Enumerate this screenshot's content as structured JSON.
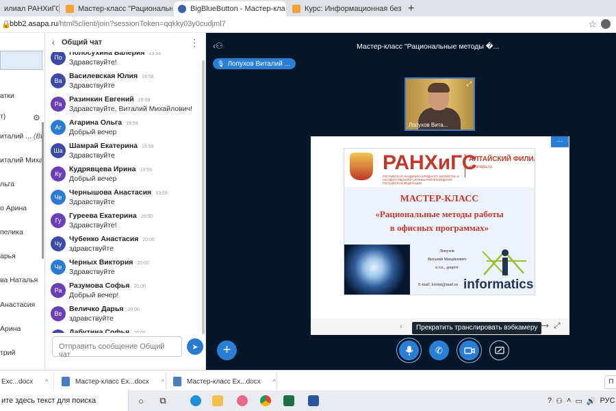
{
  "tabs": [
    {
      "label": "илиал РАНХиГС",
      "active": false
    },
    {
      "label": "Мастер-класс \"Рациональные м",
      "active": false
    },
    {
      "label": "BigBlueButton - Мастер-кла",
      "active": true
    },
    {
      "label": "Курс: Информационная безопа",
      "active": false
    }
  ],
  "new_tab": "+",
  "address": {
    "host": "bbb2.asapa.ru",
    "path": "/html5client/join?sessionToken=qqkky03y0cudjml7"
  },
  "users": [
    "",
    "атки",
    "т)",
    "италий ...",
    "италий Миха...",
    "льга",
    "о Арина",
    "пелика",
    "арья",
    "ва Наталья",
    "Анастасия",
    "Арина",
    "трий"
  ],
  "user_you_tag": "(Вы)",
  "chat": {
    "title": "Общий чат",
    "messages": [
      {
        "initials": "По",
        "color": "#3b4aa6",
        "name": "Полосухина Валерия",
        "time": "19:58",
        "text": "Здравствуйте!"
      },
      {
        "initials": "Ва",
        "color": "#3b4aa6",
        "name": "Василевская Юлия",
        "time": "19:58",
        "text": "Здравствуйте"
      },
      {
        "initials": "Ра",
        "color": "#6a3fb3",
        "name": "Разинкин Евгений",
        "time": "19:58",
        "text": "Здравствуйте, Виталий Михайлович!"
      },
      {
        "initials": "Аг",
        "color": "#2b7bd3",
        "name": "Агарина Ольга",
        "time": "19:59",
        "text": "Добрый вечер"
      },
      {
        "initials": "Ша",
        "color": "#3b4aa6",
        "name": "Шамрай Екатерина",
        "time": "19:59",
        "text": "Здравствуйте"
      },
      {
        "initials": "Ку",
        "color": "#6a3fb3",
        "name": "Кудрявцева Ирина",
        "time": "19:59",
        "text": "Добрый вечер"
      },
      {
        "initials": "Че",
        "color": "#2b7bd3",
        "name": "Чернышова Анастасия",
        "time": "19:59",
        "text": "Здравствуйте"
      },
      {
        "initials": "Гу",
        "color": "#6a3fb3",
        "name": "Гуреева Екатерина",
        "time": "20:00",
        "text": "Здравствуйте!"
      },
      {
        "initials": "Чу",
        "color": "#3b4aa6",
        "name": "Чубенко Анастасия",
        "time": "20:00",
        "text": "здравствуйте"
      },
      {
        "initials": "Че",
        "color": "#2b7bd3",
        "name": "Черных Виктория",
        "time": "20:00",
        "text": "Здравствуйте"
      },
      {
        "initials": "Ра",
        "color": "#6a3fb3",
        "name": "Разумова Софья",
        "time": "20:00",
        "text": "Добрый вечер!"
      },
      {
        "initials": "Ве",
        "color": "#6a3fb3",
        "name": "Величко Дарья",
        "time": "20:00",
        "text": "здравствуйте"
      },
      {
        "initials": "Да",
        "color": "#3b4aa6",
        "name": "Дабутина Софья",
        "time": "20:00",
        "text": ""
      }
    ],
    "input_placeholder": "Отправить сообщение Общий чат"
  },
  "meeting": {
    "title": "Мастер-класс \"Рациональные методы �...",
    "talker": "Лопухов Виталий ...",
    "webcam_name": "Лопухов Вита...",
    "tooltip": "Прекратить транслировать вэбкамеру"
  },
  "slide": {
    "brand": "РАНХиГС",
    "brand_sub": "РОССИЙСКАЯ АКАДЕМИЯ НАРОДНОГО ХОЗЯЙСТВА И ГОСУДАРСТВЕННОЙ СЛУЖБЫ ПРИ ПРЕЗИДЕНТЕ РОССИЙСКОЙ ФЕДЕРАЦИИ",
    "branch": "АЛТАЙСКИЙ ФИЛИАЛ",
    "site": "alt.ranepa.ru",
    "heading": "МАСТЕР-КЛАСС",
    "subtitle_line1": "«Рациональные методы работы",
    "subtitle_line2": "в офисных программах»",
    "author_last": "Лопухов",
    "author_first": "Виталий Михайлович",
    "author_degree": "к.т.н., доцент",
    "email": "E-mail: lovimi@mail.ru",
    "logo_text": "informatics"
  },
  "downloads": [
    {
      "label": "Exc...docx"
    },
    {
      "label": "Мастер-класс Ex...docx"
    },
    {
      "label": "Мастер-класс Ex...docx"
    }
  ],
  "show_all": "П",
  "taskbar": {
    "search": "ите здесь текст для поиска",
    "lang": "РУС"
  },
  "colors": {
    "accent": "#2a7fd4",
    "meeting_bg": "#06172a",
    "brand_red": "#c0392b"
  }
}
